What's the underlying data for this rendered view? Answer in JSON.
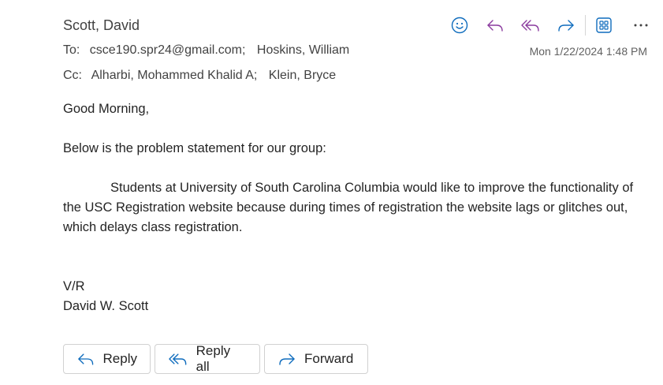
{
  "header": {
    "sender": "Scott, David",
    "to_label": "To:",
    "to": [
      "csce190.spr24@gmail.com;",
      "Hoskins, William"
    ],
    "cc_label": "Cc:",
    "cc": [
      "Alharbi, Mohammed Khalid A;",
      "Klein, Bryce"
    ],
    "date": "Mon 1/22/2024 1:48 PM"
  },
  "toolbar": {
    "icons": [
      "emoji-icon",
      "reply-icon",
      "reply-all-icon",
      "forward-icon",
      "apps-icon",
      "more-icon"
    ],
    "accent_color": "#0f6cbd",
    "replyall_color": "#8a3a9e"
  },
  "body": {
    "greeting": "Good Morning,",
    "intro": "Below is the problem statement for our group:",
    "paragraph": "Students at University of South Carolina Columbia would like to improve the functionality of the USC Registration website because during times of registration the website lags or glitches out, which delays class registration.",
    "closing": "V/R",
    "signature": "David W. Scott"
  },
  "actions": {
    "reply": "Reply",
    "reply_all": "Reply all",
    "forward": "Forward"
  }
}
